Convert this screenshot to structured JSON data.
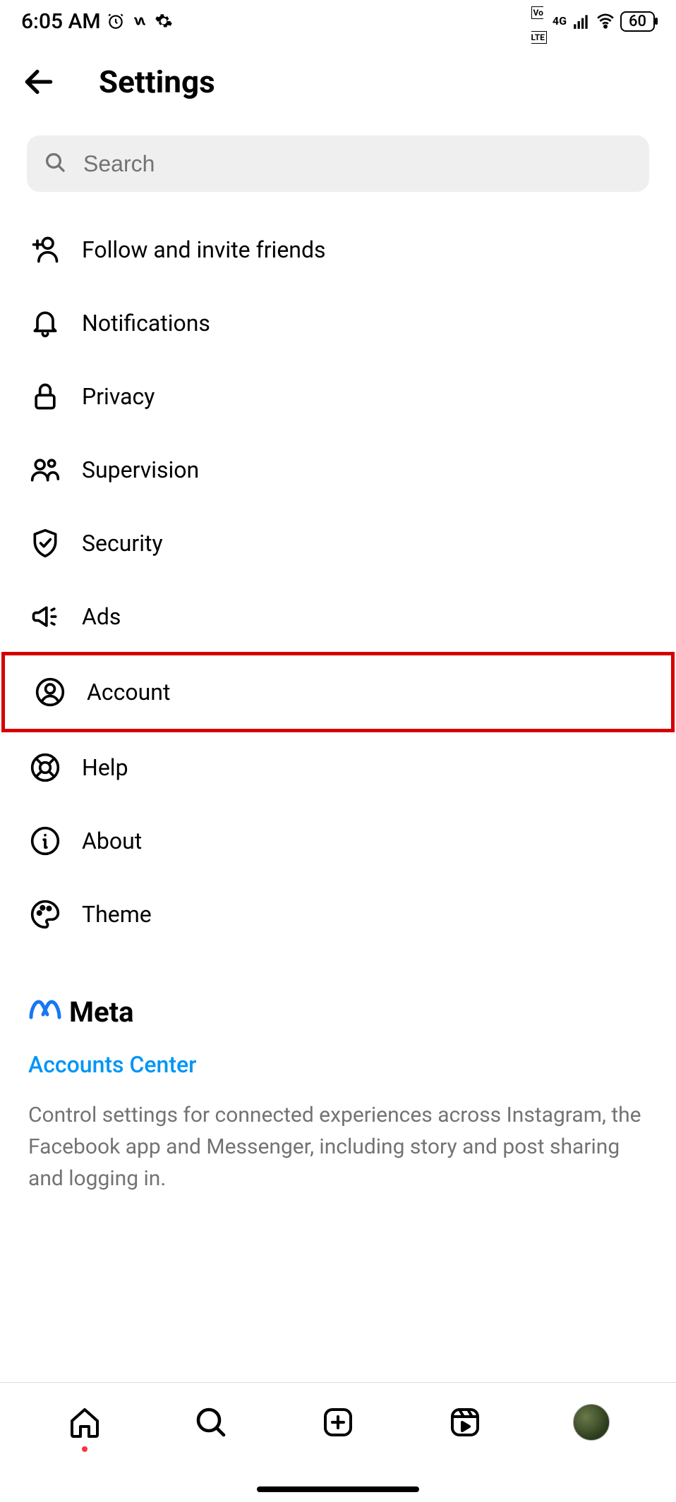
{
  "status_bar": {
    "time": "6:05 AM",
    "network_type": "4G",
    "battery": "60"
  },
  "header": {
    "title": "Settings"
  },
  "search": {
    "placeholder": "Search"
  },
  "menu_items": [
    {
      "id": "follow-invite",
      "icon": "person-add-icon",
      "label": "Follow and invite friends",
      "highlight": false
    },
    {
      "id": "notifications",
      "icon": "bell-icon",
      "label": "Notifications",
      "highlight": false
    },
    {
      "id": "privacy",
      "icon": "lock-icon",
      "label": "Privacy",
      "highlight": false
    },
    {
      "id": "supervision",
      "icon": "people-icon",
      "label": "Supervision",
      "highlight": false
    },
    {
      "id": "security",
      "icon": "shield-check-icon",
      "label": "Security",
      "highlight": false
    },
    {
      "id": "ads",
      "icon": "megaphone-icon",
      "label": "Ads",
      "highlight": false
    },
    {
      "id": "account",
      "icon": "person-circle-icon",
      "label": "Account",
      "highlight": true
    },
    {
      "id": "help",
      "icon": "lifebuoy-icon",
      "label": "Help",
      "highlight": false
    },
    {
      "id": "about",
      "icon": "info-icon",
      "label": "About",
      "highlight": false
    },
    {
      "id": "theme",
      "icon": "palette-icon",
      "label": "Theme",
      "highlight": false
    }
  ],
  "meta": {
    "brand_name": "Meta",
    "link_label": "Accounts Center",
    "description": "Control settings for connected experiences across Instagram, the Facebook app and Messenger, including story and post sharing and logging in."
  },
  "colors": {
    "highlight_border": "#d40000",
    "link_blue": "#0095f6",
    "secondary_text": "#737373",
    "search_bg": "#efefef"
  }
}
